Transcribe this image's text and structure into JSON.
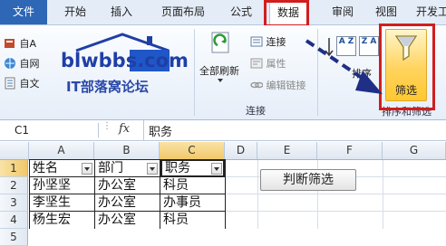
{
  "ribbon": {
    "tabs": [
      {
        "label": "文件"
      },
      {
        "label": "开始"
      },
      {
        "label": "插入"
      },
      {
        "label": "页面布局"
      },
      {
        "label": "公式"
      },
      {
        "label": "数据"
      },
      {
        "label": "审阅"
      },
      {
        "label": "视图"
      },
      {
        "label": "开发工"
      }
    ],
    "active_tab": "数据",
    "left_items": [
      "自A",
      "自网",
      "自文"
    ],
    "connections": {
      "refresh_all": "全部刷新",
      "connections": "连接",
      "properties": "属性",
      "edit_links": "编辑链接",
      "group_label": "连接"
    },
    "sort": {
      "label": "排序",
      "az": "A Z",
      "za": "Z A"
    },
    "filter": {
      "label": "筛选"
    },
    "group_label_sort": "排序和筛选"
  },
  "watermark": {
    "domain": "blwbbs.com",
    "subtitle": "IT部落窝论坛"
  },
  "formula_bar": {
    "name_box": "C1",
    "fx": "fx",
    "value": "职务"
  },
  "sheet": {
    "columns": [
      "A",
      "B",
      "C",
      "D",
      "E",
      "F",
      "G"
    ],
    "rows": [
      "1",
      "2",
      "3",
      "4",
      "5"
    ],
    "data": [
      [
        "姓名",
        "部门",
        "职务"
      ],
      [
        "孙坚坚",
        "办公室",
        "科员"
      ],
      [
        "李坚生",
        "办公室",
        "办事员"
      ],
      [
        "杨生宏",
        "办公室",
        "科员"
      ]
    ],
    "button_label": "判断筛选"
  },
  "colors": {
    "highlight": "#d11e1e",
    "file_tab": "#2d67b6",
    "arrow": "#1f2f86"
  }
}
